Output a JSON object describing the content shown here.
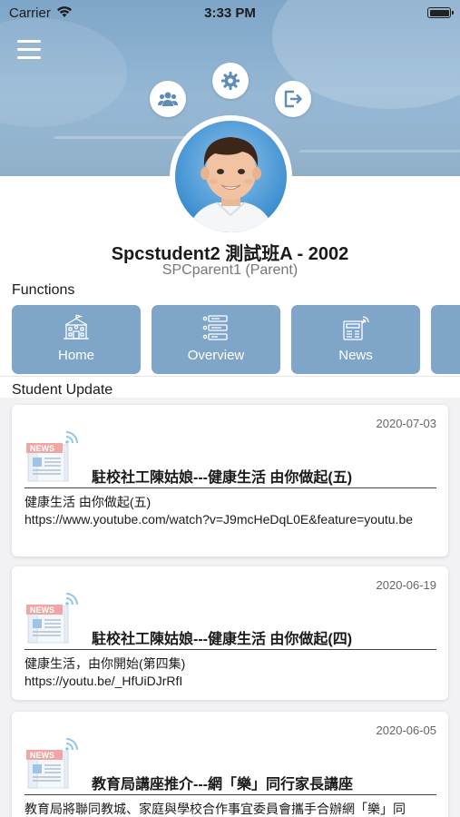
{
  "status_bar": {
    "carrier": "Carrier",
    "time": "3:33 PM"
  },
  "profile": {
    "student_name": "Spcstudent2 測試班A - 2002",
    "parent_name": "SPCparent1 (Parent)"
  },
  "header_actions": [
    {
      "icon": "group-icon"
    },
    {
      "icon": "gear-icon"
    },
    {
      "icon": "logout-icon"
    }
  ],
  "functions": {
    "title": "Functions",
    "items": [
      {
        "label": "Home",
        "icon": "school-building-icon"
      },
      {
        "label": "Overview",
        "icon": "list-icon"
      },
      {
        "label": "News",
        "icon": "news-icon"
      },
      {
        "label": "",
        "icon": ""
      }
    ]
  },
  "student_update": {
    "title": "Student Update",
    "items": [
      {
        "date": "2020-07-03",
        "title": "駐校社工陳姑娘---健康生活 由你做起(五)",
        "body": "健康生活 由你做起(五)\nhttps://www.youtube.com/watch?v=J9mcHeDqL0E&feature=youtu.be"
      },
      {
        "date": "2020-06-19",
        "title": "駐校社工陳姑娘---健康生活 由你做起(四)",
        "body": "健康生活，由你開始(第四集)\nhttps://youtu.be/_HfUiDJrRfI"
      },
      {
        "date": "2020-06-05",
        "title": "教育局講座推介---網「樂」同行家長講座",
        "body": "教育局將聯同教城、家庭與學校合作事宜委員會攜手合辦網「樂」同"
      }
    ]
  },
  "colors": {
    "card": "#7fa6c9",
    "banner": "#8fb3d2",
    "news_red": "#f2a5a5"
  }
}
